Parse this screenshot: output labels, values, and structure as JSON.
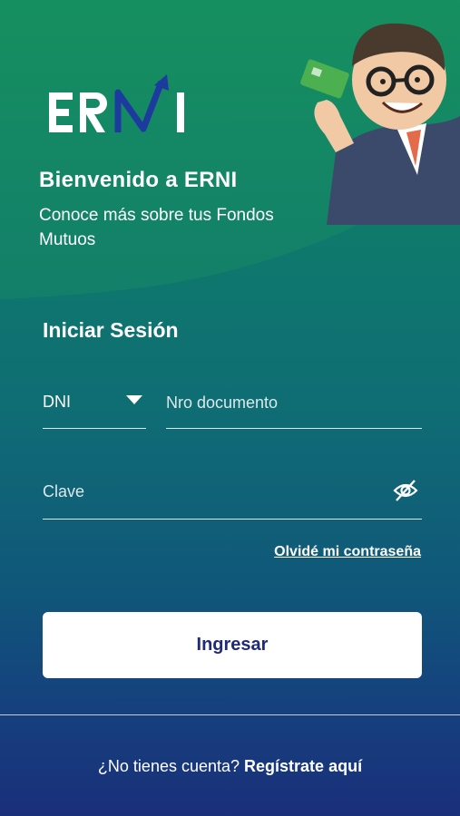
{
  "brand": {
    "logo_text": "ERNI",
    "colors": {
      "background_top": "#138a62",
      "background_bottom": "#1a2f7a",
      "button_text": "#1e2a7a",
      "logo_accent": "#1d3a9e"
    }
  },
  "welcome": {
    "title": "Bienvenido a ERNI",
    "subtitle": "Conoce más sobre tus Fondos Mutuos"
  },
  "login": {
    "title": "Iniciar Sesión",
    "doc_type": {
      "value": "DNI",
      "icon": "caret-down-icon"
    },
    "doc_number": {
      "placeholder": "Nro documento",
      "value": ""
    },
    "password": {
      "placeholder": "Clave",
      "value": "",
      "icon": "eye-off-icon"
    },
    "forgot_link": "Olvidé mi contraseña",
    "submit_label": "Ingresar"
  },
  "footer": {
    "prompt": "¿No tienes cuenta?",
    "register_link": "Regístrate aquí"
  }
}
